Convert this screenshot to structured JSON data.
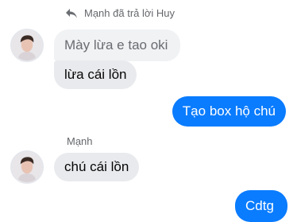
{
  "reply_header": {
    "text": "Mạnh đã trả lời Huy",
    "icon": "reply-arrow-icon"
  },
  "messages": {
    "quoted_text": "Mày lừa e tao oki",
    "incoming_1": "lừa cái lồn",
    "outgoing_1": "Tạo box hộ chú",
    "sender_name": "Mạnh",
    "incoming_2": "chú cái lồn",
    "outgoing_2": "Cdtg"
  },
  "colors": {
    "outgoing_bubble": "#0a7cff",
    "incoming_bubble": "#e9eaed",
    "meta_text": "#65676b"
  }
}
